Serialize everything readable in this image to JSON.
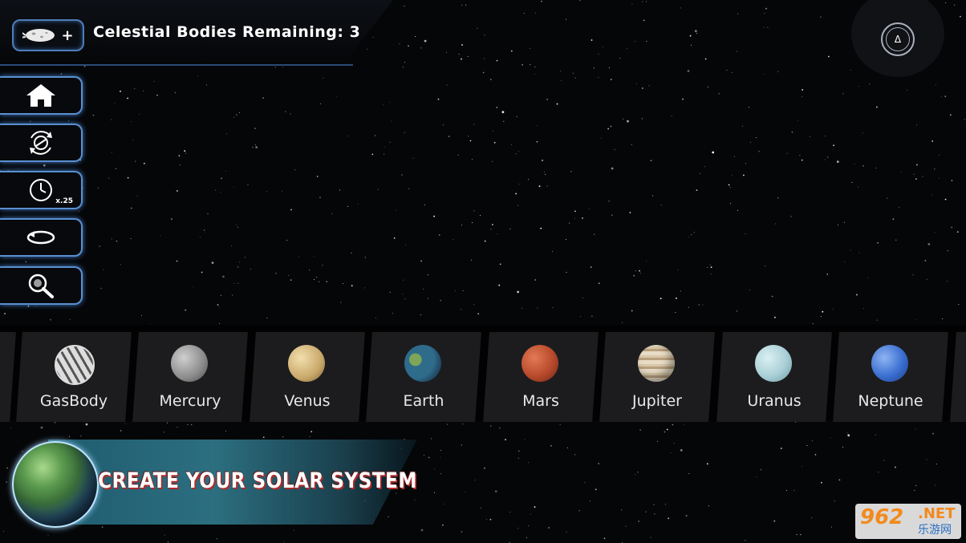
{
  "hud": {
    "add_body_icon": "asteroid-plus-icon",
    "counter_label": "Celestial Bodies Remaining: 3"
  },
  "compass": {
    "symbol": "Δ",
    "icon": "compass-icon"
  },
  "tools": [
    {
      "name": "home-button",
      "icon": "home-icon"
    },
    {
      "name": "rotate-view-button",
      "icon": "rotate-orbit-icon"
    },
    {
      "name": "time-speed-button",
      "icon": "clock-icon",
      "label": "x.25"
    },
    {
      "name": "orbit-button",
      "icon": "orbit-loop-icon"
    },
    {
      "name": "zoom-button",
      "icon": "magnifier-icon"
    }
  ],
  "planets": [
    {
      "label": "GasBody",
      "color": "#8a8a8a"
    },
    {
      "label": "Mercury",
      "color": "#9a9a9a"
    },
    {
      "label": "Venus",
      "color": "#c9b07a"
    },
    {
      "label": "Earth",
      "color": "#2f6b8a"
    },
    {
      "label": "Mars",
      "color": "#b84a2c"
    },
    {
      "label": "Jupiter",
      "color": "#c9b59a"
    },
    {
      "label": "Uranus",
      "color": "#a9cfd6"
    },
    {
      "label": "Neptune",
      "color": "#3a6fd1"
    }
  ],
  "banner": {
    "title": "CREATE YOUR SOLAR SYSTEM"
  },
  "watermark": {
    "number": "962",
    "suffix": ".NET",
    "cn": "乐游网"
  }
}
